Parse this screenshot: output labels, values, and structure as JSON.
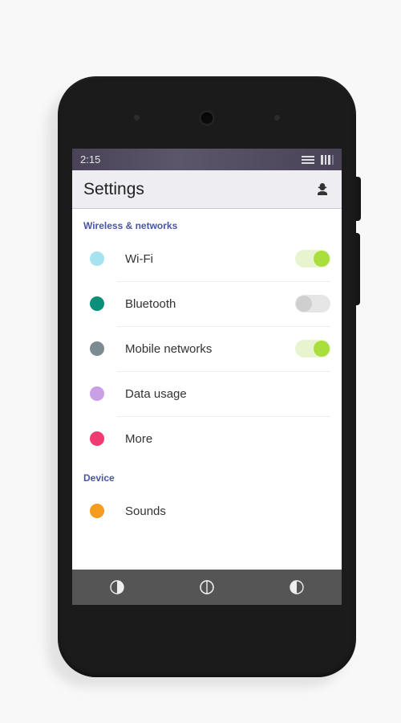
{
  "statusbar": {
    "time": "2:15"
  },
  "header": {
    "title": "Settings"
  },
  "sections": [
    {
      "title": "Wireless & networks",
      "items": [
        {
          "label": "Wi-Fi",
          "color": "#a7e3ee",
          "toggle": true,
          "on": true
        },
        {
          "label": "Bluetooth",
          "color": "#0a8f7a",
          "toggle": true,
          "on": false
        },
        {
          "label": "Mobile networks",
          "color": "#7c8b92",
          "toggle": true,
          "on": true
        },
        {
          "label": "Data usage",
          "color": "#c9a0e6",
          "toggle": false
        },
        {
          "label": "More",
          "color": "#ef3b72",
          "toggle": false
        }
      ]
    },
    {
      "title": "Device",
      "items": [
        {
          "label": "Sounds",
          "color": "#f59b1d",
          "toggle": false
        }
      ]
    }
  ]
}
